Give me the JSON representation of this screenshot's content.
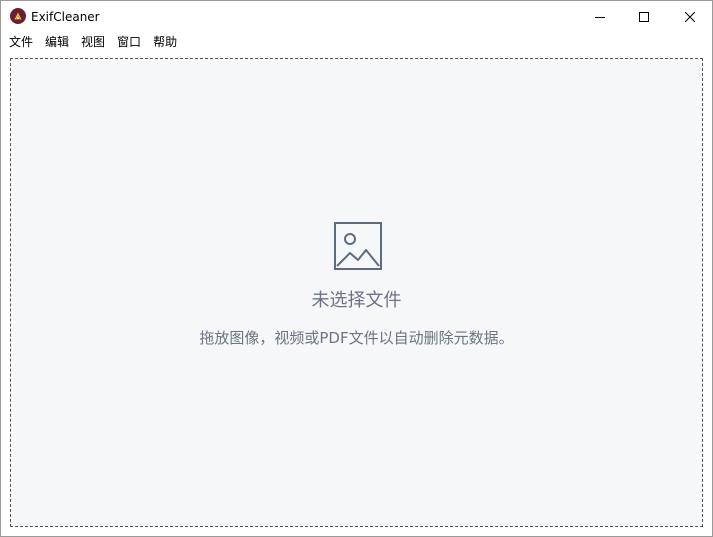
{
  "window": {
    "title": "ExifCleaner",
    "icon": "exifcleaner-logo-icon"
  },
  "window_controls": {
    "minimize_icon": "minimize-icon",
    "maximize_icon": "maximize-icon",
    "close_icon": "close-icon"
  },
  "menu": {
    "items": [
      {
        "label": "文件"
      },
      {
        "label": "编辑"
      },
      {
        "label": "视图"
      },
      {
        "label": "窗口"
      },
      {
        "label": "帮助"
      }
    ]
  },
  "dropzone": {
    "icon": "image-icon",
    "title": "未选择文件",
    "subtitle": "拖放图像，视频或PDF文件以自动删除元数据。"
  },
  "colors": {
    "dropzone_bg": "#f6f7f9",
    "text_muted": "#6b7483",
    "icon_stroke": "#5f6b7d",
    "logo_bg": "#6a1f33"
  }
}
